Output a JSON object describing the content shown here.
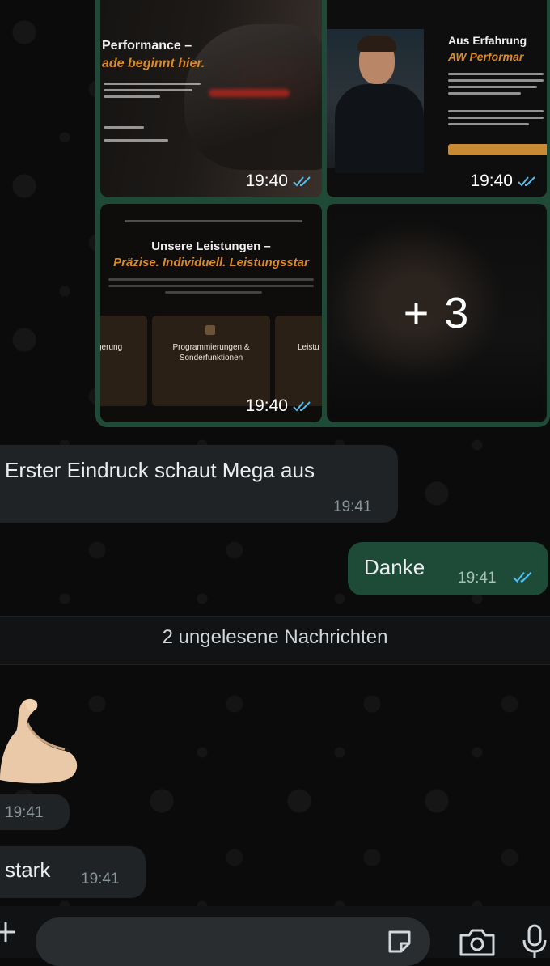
{
  "media_grid": {
    "tile1": {
      "headline_line1": "Performance –",
      "headline_line2": "ade beginnt hier.",
      "time": "19:40"
    },
    "tile2": {
      "headline_line1": "Aus Erfahrung",
      "headline_line2": "AW Performar",
      "time": "19:40"
    },
    "tile3": {
      "headline_line1": "Unsere Leistungen –",
      "headline_line2": "Präzise. Individuell. Leistungsstar",
      "card_left_title": "gerung",
      "card_center_title_line1": "Programmierungen &",
      "card_center_title_line2": "Sonderfunktionen",
      "card_right_title": "Leistu",
      "time": "19:40"
    },
    "tile4": {
      "more_count": "+ 3"
    },
    "read_color": "#53bdeb"
  },
  "messages": [
    {
      "direction": "incoming",
      "text": "Erster Eindruck schaut Mega aus",
      "time": "19:41"
    },
    {
      "direction": "outgoing",
      "text": "Danke",
      "time": "19:41",
      "status": "read"
    },
    {
      "direction": "incoming",
      "kind": "emoji",
      "emoji_name": "flexed-biceps-icon",
      "time": "19:41"
    },
    {
      "direction": "incoming",
      "text": "stark",
      "time": "19:41"
    }
  ],
  "unread_divider": "2 ungelesene Nachrichten",
  "composer": {
    "placeholder": "",
    "icons": [
      "plus-icon",
      "sticker-icon",
      "camera-icon",
      "microphone-icon"
    ]
  },
  "colors": {
    "background": "#0b0b0b",
    "incoming_bubble": "#1f2326",
    "outgoing_bubble": "#1e4a38",
    "accent_orange": "#d98a2b"
  }
}
